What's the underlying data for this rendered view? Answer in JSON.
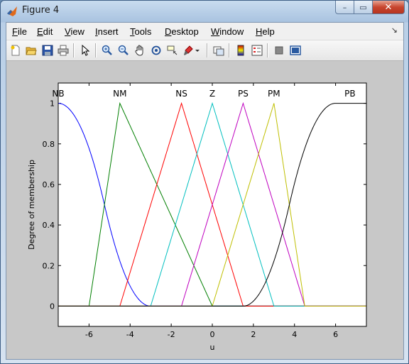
{
  "window": {
    "title": "Figure 4",
    "minimize_glyph": "–",
    "maximize_glyph": "▭",
    "close_glyph": "✕"
  },
  "menu": [
    {
      "label": "File",
      "accel": "F",
      "rest": "ile"
    },
    {
      "label": "Edit",
      "accel": "E",
      "rest": "dit"
    },
    {
      "label": "View",
      "accel": "V",
      "rest": "iew"
    },
    {
      "label": "Insert",
      "accel": "I",
      "rest": "nsert"
    },
    {
      "label": "Tools",
      "accel": "T",
      "rest": "ools"
    },
    {
      "label": "Desktop",
      "accel": "D",
      "rest": "esktop"
    },
    {
      "label": "Window",
      "accel": "W",
      "rest": "indow"
    },
    {
      "label": "Help",
      "accel": "H",
      "rest": "elp"
    }
  ],
  "menu_overflow_glyph": "↘",
  "toolbar": [
    "new-figure-icon",
    "open-file-icon",
    "save-icon",
    "print-icon",
    "edit-plot-arrow-icon",
    "zoom-in-icon",
    "zoom-out-icon",
    "pan-hand-icon",
    "rotate-3d-icon",
    "data-cursor-icon",
    "brush-icon",
    "brush-dropdown-icon",
    "link-plot-icon",
    "colorbar-icon",
    "legend-icon",
    "hide-plot-tools-icon",
    "show-plot-tools-icon"
  ],
  "chart_data": {
    "type": "line",
    "title": "",
    "xlabel": "u",
    "ylabel": "Degree of membership",
    "xlim": [
      -7.5,
      7.5
    ],
    "ylim": [
      -0.1,
      1.1
    ],
    "xticks": [
      -6,
      -4,
      -2,
      0,
      2,
      4,
      6
    ],
    "yticks": [
      0,
      0.2,
      0.4,
      0.6,
      0.8,
      1
    ],
    "xtick_labels": [
      "-6",
      "-4",
      "-2",
      "0",
      "2",
      "4",
      "6"
    ],
    "ytick_labels": [
      "0",
      "0.2",
      "0.4",
      "0.6",
      "0.8",
      "1"
    ],
    "grid": false,
    "series": [
      {
        "name": "NB",
        "shape": "zmf",
        "params": [
          -7.5,
          -3
        ],
        "color": "#0000ff",
        "label_x": -7.5
      },
      {
        "name": "NM",
        "shape": "trimf",
        "params": [
          -6,
          -4.5,
          0
        ],
        "color": "#007f00",
        "label_x": -4.5
      },
      {
        "name": "NS",
        "shape": "trimf",
        "params": [
          -4.5,
          -1.5,
          1.5
        ],
        "color": "#ff0000",
        "label_x": -1.5
      },
      {
        "name": "Z",
        "shape": "trimf",
        "params": [
          -3,
          0,
          3
        ],
        "color": "#00bfbf",
        "label_x": 0
      },
      {
        "name": "PS",
        "shape": "trimf",
        "params": [
          -1.5,
          1.5,
          4.5
        ],
        "color": "#bf00bf",
        "label_x": 1.5
      },
      {
        "name": "PM",
        "shape": "trimf",
        "params": [
          0,
          3,
          4.5
        ],
        "color": "#bfbf00",
        "label_x": 3
      },
      {
        "name": "PB",
        "shape": "smf",
        "params": [
          1.5,
          6
        ],
        "color": "#000000",
        "label_x": 6.7
      }
    ],
    "baseline": {
      "y": 0,
      "color": "#000000"
    }
  }
}
